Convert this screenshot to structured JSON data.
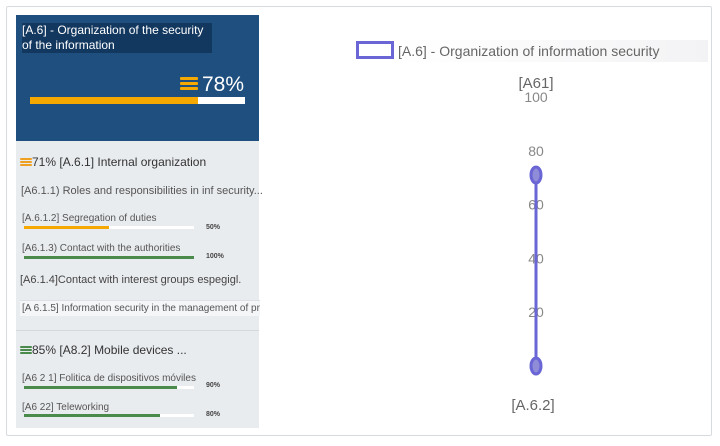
{
  "panel": {
    "header": {
      "title": "[A.6] - Organization of the security of the information",
      "percent_label": "78%",
      "progress": 0.78,
      "bar_color": "#f5a800",
      "background": "#1f4f7f"
    },
    "groups": [
      {
        "percent_label": "71%",
        "title": "[A.6.1] Internal organization",
        "icon": "stack-icon",
        "icon_color": "#f0a020",
        "items": [
          {
            "label": "[A6.1.1) Roles and responsibilities in inf security...",
            "percent_label": "",
            "progress": null
          },
          {
            "label": "[A.6.1.2] Segregation of duties",
            "percent_label": "50%",
            "progress": 0.5,
            "color": "#f5a800"
          },
          {
            "label": "[A6.1.3) Contact with the authorities",
            "percent_label": "100%",
            "progress": 1.0,
            "color": "#4a8a4a"
          },
          {
            "label": "[A6.1.4]Contact with interest groups espegigl.",
            "percent_label": "",
            "progress": null
          },
          {
            "label": "[A 6.1.5] Information security in the management of pro...",
            "percent_label": "",
            "progress": null
          }
        ]
      },
      {
        "percent_label": "85%",
        "title": "[A8.2] Mobile devices ...",
        "icon": "stack-icon",
        "icon_color": "#4a8a4a",
        "items": [
          {
            "label": "[A6 2 1] Folitica de dispositivos móviles",
            "percent_label": "90%",
            "progress": 0.9,
            "color": "#4a8a4a"
          },
          {
            "label": "[A6 22] Teleworking",
            "percent_label": "80%",
            "progress": 0.8,
            "color": "#4a8a4a"
          }
        ]
      }
    ]
  },
  "chart_data": {
    "type": "line",
    "title": "",
    "legend": [
      "[A.6] - Organization of information security"
    ],
    "legend_position": "top",
    "axes_labels": [
      "[A61]",
      "[A.6.2]"
    ],
    "ticks": [
      "100",
      "80",
      "60",
      "40",
      "20"
    ],
    "ylim": [
      0,
      100
    ],
    "series": [
      {
        "name": "[A.6] - Organization of information security",
        "values": [
          71,
          0
        ],
        "color": "#6a66d6"
      }
    ]
  }
}
